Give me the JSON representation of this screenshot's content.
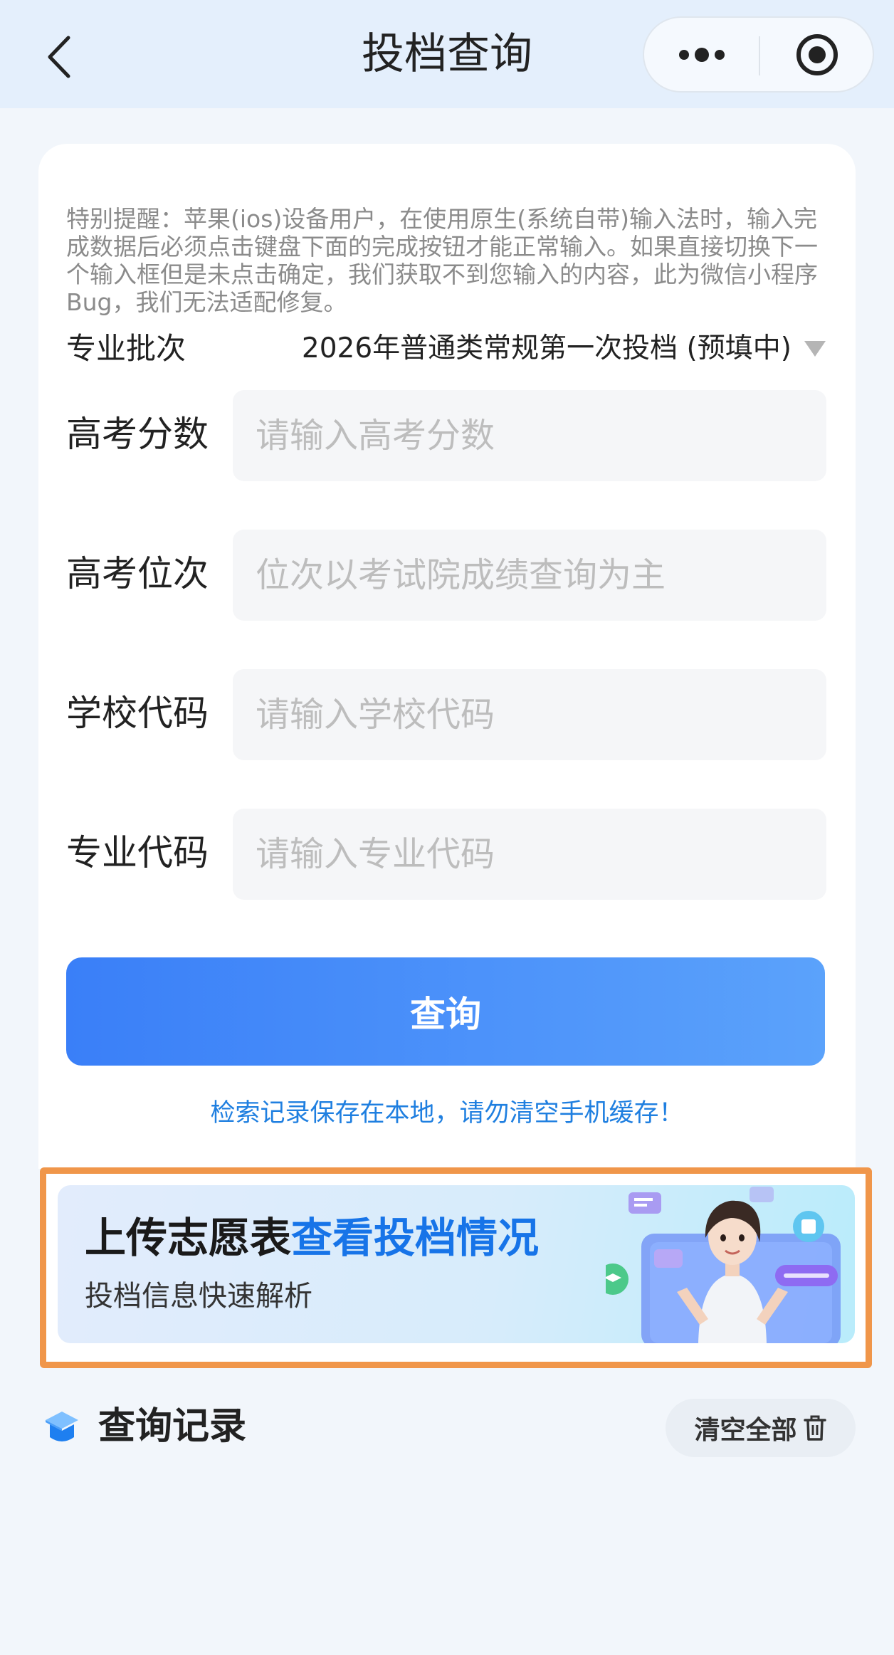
{
  "header": {
    "title": "投档查询",
    "back_icon": "chevron-left-icon",
    "more_icon": "more-dots-icon",
    "close_icon": "target-close-icon"
  },
  "form": {
    "notice": "特别提醒：苹果(ios)设备用户，在使用原生(系统自带)输入法时，输入完成数据后必须点击键盘下面的完成按钮才能正常输入。如果直接切换下一个输入框但是未点击确定，我们获取不到您输入的内容，此为微信小程序Bug，我们无法适配修复。",
    "batch": {
      "label": "专业批次",
      "value": "2026年普通类常规第一次投档 (预填中)"
    },
    "fields": [
      {
        "label": "高考分数",
        "value": "",
        "placeholder": "请输入高考分数"
      },
      {
        "label": "高考位次",
        "value": "",
        "placeholder": "位次以考试院成绩查询为主"
      },
      {
        "label": "学校代码",
        "value": "",
        "placeholder": "请输入学校代码"
      },
      {
        "label": "专业代码",
        "value": "",
        "placeholder": "请输入专业代码"
      }
    ],
    "query_button": "查询",
    "save_tip": "检索记录保存在本地，请勿清空手机缓存！"
  },
  "banner": {
    "title_dark": "上传志愿表",
    "title_blue": "查看投档情况",
    "subtitle": "投档信息快速解析"
  },
  "records": {
    "title": "查询记录",
    "clear_button": "清空全部",
    "clear_icon": "trash-icon"
  },
  "colors": {
    "primary": "#3a7ff8",
    "link": "#1f7fe0",
    "highlight_border": "#f0964a"
  }
}
